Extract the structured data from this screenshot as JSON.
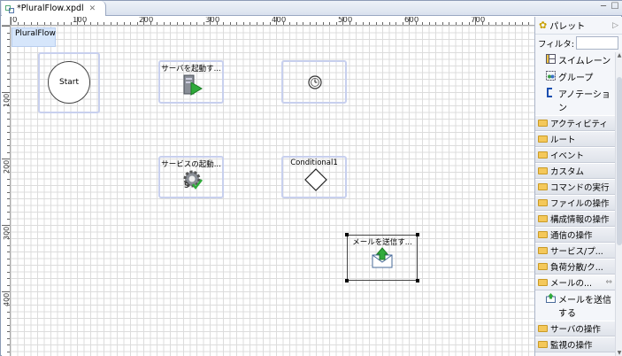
{
  "editor": {
    "tab_title": "*PluralFlow.xpdl",
    "tab_close": "✕",
    "win_min": "─",
    "win_max": "☐"
  },
  "ruler": {
    "h_labels": [
      "0",
      "100",
      "200",
      "300",
      "400",
      "500",
      "600",
      "700"
    ],
    "v_labels": [
      "100",
      "200",
      "300",
      "400"
    ]
  },
  "canvas": {
    "pool_label": "PluralFlow",
    "nodes": {
      "start": "Start",
      "start_server": "サーバを起動す...",
      "timer": "",
      "start_service": "サービスの起動...",
      "conditional": "Conditional1",
      "send_mail": "メールを送信す..."
    }
  },
  "palette": {
    "title": "パレット",
    "filter_label": "フィルタ:",
    "filter_value": "",
    "tools": [
      "スイムレーン",
      "グループ",
      "アノテーション"
    ],
    "drawers": [
      "アクティビティ",
      "ルート",
      "イベント",
      "カスタム",
      "コマンドの実行",
      "ファイルの操作",
      "構成情報の操作",
      "通信の操作",
      "サービス/プ...",
      "負荷分散/ク..."
    ],
    "open_drawer": "メールの...",
    "open_drawer_item": "メールを送信する",
    "drawers_after": [
      "サーバの操作",
      "監視の操作"
    ]
  }
}
